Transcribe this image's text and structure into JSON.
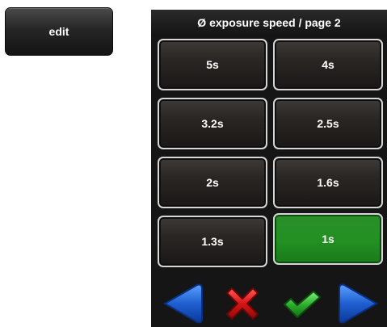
{
  "edit_button": {
    "label": "edit"
  },
  "panel": {
    "title": "Ø exposure speed / page 2",
    "options": [
      "5s",
      "4s",
      "3.2s",
      "2.5s",
      "2s",
      "1.6s",
      "1.3s",
      "1s"
    ],
    "selected": "1s"
  },
  "nav": {
    "prev_icon": "left-arrow-icon",
    "cancel_icon": "red-x-icon",
    "confirm_icon": "checkmark-icon",
    "next_icon": "right-arrow-icon"
  },
  "colors": {
    "panel_bg": "#151515",
    "selected_green": "#229022",
    "arrow_blue": "#1f5fd0",
    "cancel_red": "#d81414",
    "confirm_green": "#2aa82a"
  }
}
